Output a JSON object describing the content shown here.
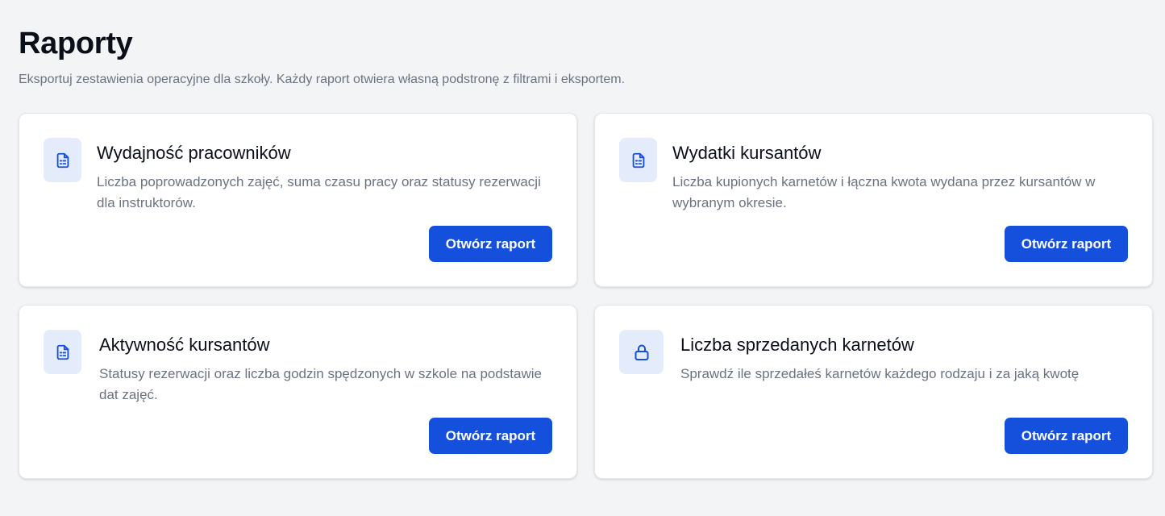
{
  "header": {
    "title": "Raporty",
    "subtitle": "Eksportuj zestawienia operacyjne dla szkoły. Każdy raport otwiera własną podstronę z filtrami i eksportem."
  },
  "colors": {
    "accent": "#1450dc",
    "icon_bg": "#e4ecfb",
    "page_bg": "#f3f4f6"
  },
  "cards": [
    {
      "icon": "report-document-icon",
      "title": "Wydajność pracowników",
      "description": "Liczba poprowadzonych zajęć, suma czasu pracy oraz statusy rezerwacji dla instruktorów.",
      "button_label": "Otwórz raport"
    },
    {
      "icon": "report-document-icon",
      "title": "Wydatki kursantów",
      "description": "Liczba kupionych karnetów i łączna kwota wydana przez kursantów w wybranym okresie.",
      "button_label": "Otwórz raport"
    },
    {
      "icon": "report-document-icon",
      "title": "Aktywność kursantów",
      "description": "Statusy rezerwacji oraz liczba godzin spędzonych w szkole na podstawie dat zajęć.",
      "button_label": "Otwórz raport"
    },
    {
      "icon": "lock-icon",
      "title": "Liczba sprzedanych karnetów",
      "description": "Sprawdź ile sprzedałeś karnetów każdego rodzaju i za jaką kwotę",
      "button_label": "Otwórz raport"
    }
  ]
}
